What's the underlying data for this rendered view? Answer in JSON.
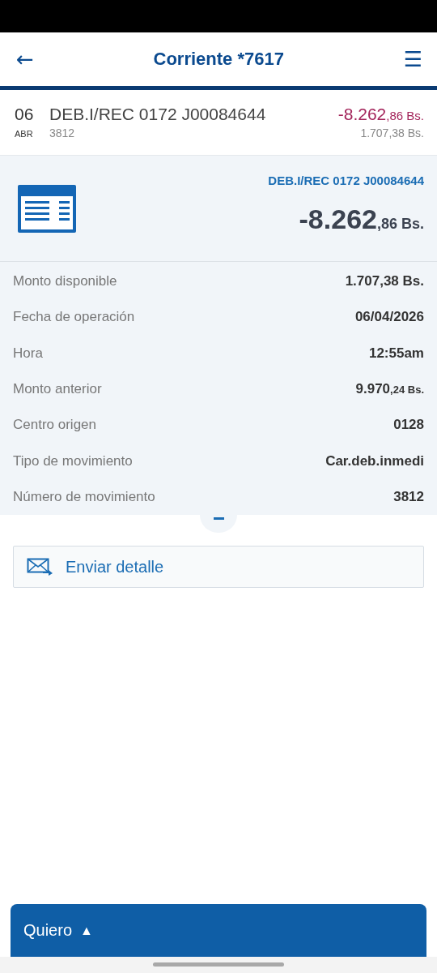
{
  "header": {
    "back": "←",
    "title": "Corriente *7617",
    "menu": "☰"
  },
  "transaction": {
    "day": "06",
    "month": "ABR",
    "description": "DEB.I/REC 0172 J00084644",
    "reference": "3812",
    "amount": {
      "main": "-8.262",
      "decimals": ",86 Bs."
    },
    "balance": "1.707,38 Bs."
  },
  "detail": {
    "title": "DEB.I/REC 0172 J00084644",
    "amount": {
      "main": "-8.262",
      "decimals": ",86 Bs."
    },
    "rows": [
      {
        "label": "Monto disponible",
        "kind": "text",
        "value": "1.707,38 Bs."
      },
      {
        "label": "Fecha de operación",
        "kind": "text",
        "value": "06/04/2026"
      },
      {
        "label": "Hora",
        "kind": "text",
        "value": "12:55am"
      },
      {
        "label": "Monto anterior",
        "kind": "amount",
        "main": "9.970",
        "decimals": ",24 Bs."
      },
      {
        "label": "Centro origen",
        "kind": "text",
        "value": "0128"
      },
      {
        "label": "Tipo de movimiento",
        "kind": "text",
        "value": "Car.deb.inmedi"
      },
      {
        "label": "Número de movimiento",
        "kind": "text",
        "value": "3812"
      }
    ],
    "expanded": true
  },
  "send_button": "Enviar detalle",
  "bottom_bar": {
    "label": "Quiero",
    "caret": "▲"
  }
}
